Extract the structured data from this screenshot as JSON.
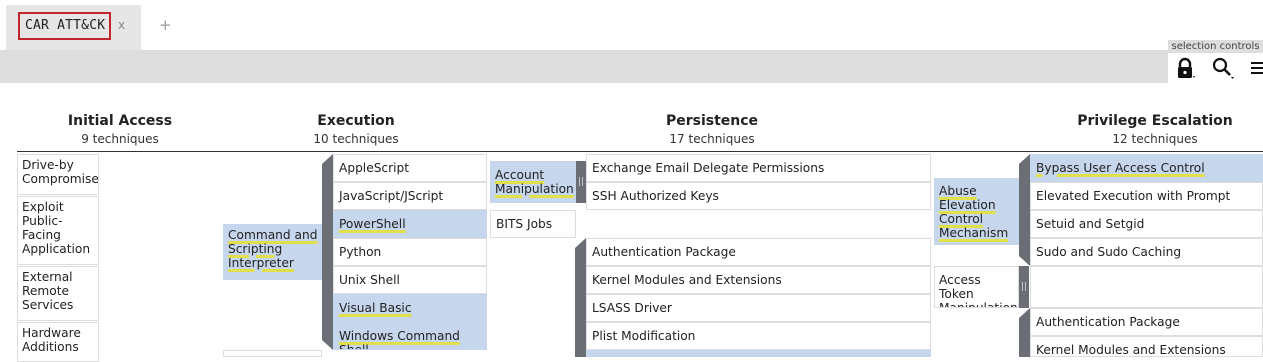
{
  "tab": {
    "label": "CAR ATT&CK",
    "close": "x",
    "add": "+"
  },
  "toolbar": {
    "selection_controls_label": "selection controls",
    "icons": [
      "lock-icon",
      "search-icon",
      "menu-icon"
    ]
  },
  "tactics": [
    {
      "name": "Initial Access",
      "count": "9 techniques"
    },
    {
      "name": "Execution",
      "count": "10 techniques"
    },
    {
      "name": "Persistence",
      "count": "17 techniques"
    },
    {
      "name": "Privilege Escalation",
      "count": "12 techniques"
    }
  ],
  "initial_access": [
    "Drive-by Compromise",
    "Exploit Public-Facing Application",
    "External Remote Services",
    "Hardware Additions"
  ],
  "execution": {
    "parent": "Command and Scripting Interpreter",
    "subs": [
      "AppleScript",
      "JavaScript/JScript",
      "PowerShell",
      "Python",
      "Unix Shell",
      "Visual Basic",
      "Windows Command Shell"
    ]
  },
  "persistence": {
    "parent1": "Account Manipulation",
    "subs1": [
      "Exchange Email Delegate Permissions",
      "SSH Authorized Keys"
    ],
    "bits": "BITS Jobs",
    "subs2": [
      "Authentication Package",
      "Kernel Modules and Extensions",
      "LSASS Driver",
      "Plist Modification"
    ]
  },
  "privesc": {
    "parent1": "Abuse Elevation Control Mechanism",
    "subs1": [
      "Bypass User Access Control",
      "Elevated Execution with Prompt",
      "Setuid and Setgid",
      "Sudo and Sudo Caching"
    ],
    "parent2": "Access Token Manipulation",
    "subs2": [
      "Authentication Package",
      "Kernel Modules and Extensions"
    ]
  },
  "colors": {
    "selected": "#c6d6ec",
    "underline": "#e0e04a",
    "highlight_border": "#c0262c",
    "sidebar": "#6b6e74"
  }
}
